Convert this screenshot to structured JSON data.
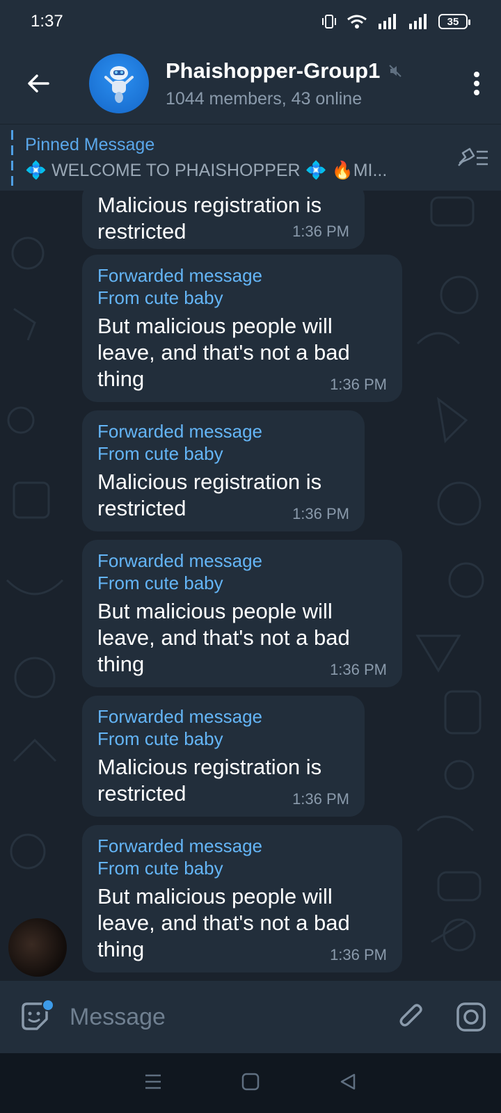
{
  "status_bar": {
    "time": "1:37",
    "battery": "35"
  },
  "header": {
    "title": "Phaishopper-Group1",
    "subtitle": "1044 members, 43 online"
  },
  "pinned": {
    "label": "Pinned Message",
    "text": "💠 WELCOME TO PHAISHOPPER 💠    🔥MI..."
  },
  "messages": [
    {
      "forward_label": "",
      "from": "",
      "text": "Malicious registration is restricted",
      "time": "1:36 PM"
    },
    {
      "forward_label": "Forwarded message",
      "from": "From cute baby",
      "text": "But malicious people will leave, and that's not a bad thing",
      "time": "1:36 PM"
    },
    {
      "forward_label": "Forwarded message",
      "from": "From cute baby",
      "text": "Malicious registration is restricted",
      "time": "1:36 PM"
    },
    {
      "forward_label": "Forwarded message",
      "from": "From cute baby",
      "text": "But malicious people will leave, and that's not a bad thing",
      "time": "1:36 PM"
    },
    {
      "forward_label": "Forwarded message",
      "from": "From cute baby",
      "text": "Malicious registration is restricted",
      "time": "1:36 PM"
    },
    {
      "forward_label": "Forwarded message",
      "from": "From cute baby",
      "text": "But malicious people will leave, and that's not a bad thing",
      "time": "1:36 PM"
    }
  ],
  "input": {
    "placeholder": "Message"
  },
  "icons": {
    "back": "arrow-left-icon",
    "menu": "more-vertical-icon",
    "mute": "muted-icon",
    "unpin": "pin-list-icon",
    "emoji": "sticker-icon",
    "attach": "paperclip-icon",
    "camera": "camera-icon"
  },
  "colors": {
    "accent": "#64b5f6",
    "header_bg": "#222e3b",
    "chat_bg": "#1a222c",
    "bubble_bg": "#222e3b"
  }
}
